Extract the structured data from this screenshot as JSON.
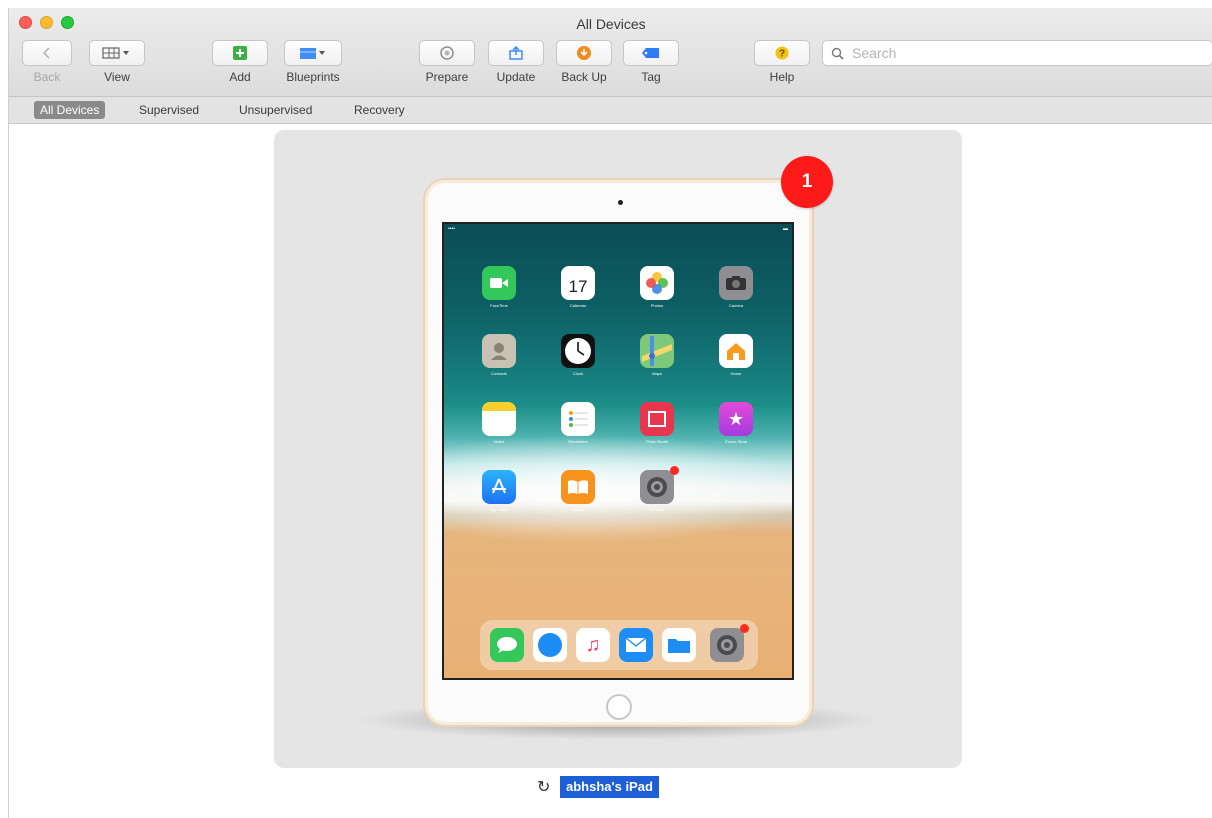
{
  "window": {
    "title": "All Devices"
  },
  "toolbar": {
    "back_label": "Back",
    "view_label": "View",
    "add_label": "Add",
    "blueprints_label": "Blueprints",
    "prepare_label": "Prepare",
    "update_label": "Update",
    "backup_label": "Back Up",
    "tag_label": "Tag",
    "help_label": "Help",
    "search_placeholder": "Search"
  },
  "scope_bar": {
    "items": [
      {
        "label": "All Devices",
        "active": true
      },
      {
        "label": "Supervised",
        "active": false
      },
      {
        "label": "Unsupervised",
        "active": false
      },
      {
        "label": "Recovery",
        "active": false
      }
    ]
  },
  "device": {
    "name": "abhsha's iPad",
    "badge_count": "1",
    "homescreen": {
      "calendar_day": "17",
      "rows": [
        [
          "FaceTime",
          "Calendar",
          "Photos",
          "Camera"
        ],
        [
          "Contacts",
          "Clock",
          "Maps",
          "Home"
        ],
        [
          "Notes",
          "Reminders",
          "Photo Booth",
          "iTunes Store"
        ],
        [
          "App Store",
          "iBooks",
          "Settings"
        ]
      ],
      "dock": [
        "Messages",
        "Safari",
        "Music",
        "Mail",
        "Files",
        "Settings"
      ]
    }
  },
  "colors": {
    "badge": "#ff1a1a",
    "selection": "#1e5fd6",
    "card_background": "#e5e5e5"
  }
}
